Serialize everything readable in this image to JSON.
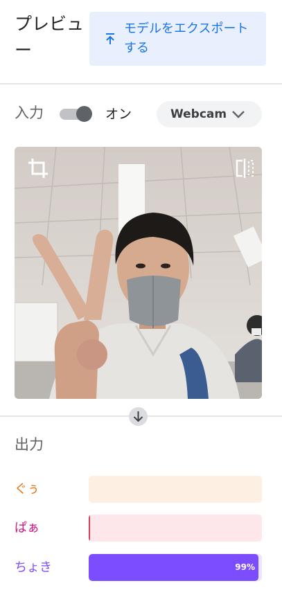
{
  "header": {
    "title": "プレビュー",
    "export_label": "モデルをエクスポートする"
  },
  "input": {
    "label": "入力",
    "toggle_state": "オン",
    "toggle_on": true,
    "source_selected": "Webcam"
  },
  "output": {
    "label": "出力",
    "classes": [
      {
        "name": "ぐぅ",
        "confidence": 0.0,
        "label_color": "#e8710a",
        "track_color": "#feefe3",
        "fill_color": "#e8710a",
        "percent_text": ""
      },
      {
        "name": "ぱぁ",
        "confidence": 0.01,
        "label_color": "#d01884",
        "track_color": "#fde7ea",
        "fill_color": "#d93d57",
        "percent_text": ""
      },
      {
        "name": "ちょき",
        "confidence": 0.99,
        "label_color": "#7c4dff",
        "track_color": "#ece5ff",
        "fill_color": "#7c4dff",
        "percent_text": "99%"
      }
    ]
  },
  "icons": {
    "export": "upload-icon",
    "dropdown": "chevron-down-icon",
    "crop": "crop-icon",
    "flip": "flip-horizontal-icon",
    "arrow": "arrow-down-icon"
  },
  "colors": {
    "accent": "#1a73e8",
    "export_bg": "#e8f0fe"
  }
}
